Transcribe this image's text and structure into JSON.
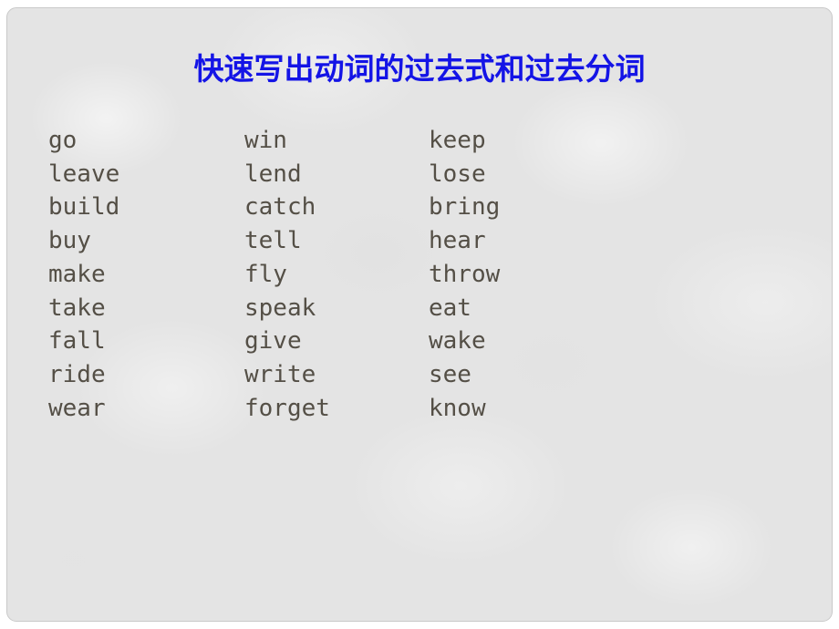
{
  "slide": {
    "title": "快速写出动词的过去式和过去分词",
    "title_color": "#1414e6",
    "background_color": "#e4e4e4",
    "word_color": "#544f46",
    "columns": [
      {
        "name": "column-1",
        "words": [
          "go",
          "leave",
          "build",
          "buy",
          "make",
          "take",
          "fall",
          "ride",
          "wear"
        ]
      },
      {
        "name": "column-2",
        "words": [
          "win",
          "lend",
          "catch",
          "tell",
          "fly",
          "speak",
          "give",
          "write",
          "forget"
        ]
      },
      {
        "name": "column-3",
        "words": [
          "keep",
          "lose",
          "bring",
          "hear",
          "throw",
          "eat",
          "wake",
          "see",
          "know"
        ]
      }
    ]
  }
}
